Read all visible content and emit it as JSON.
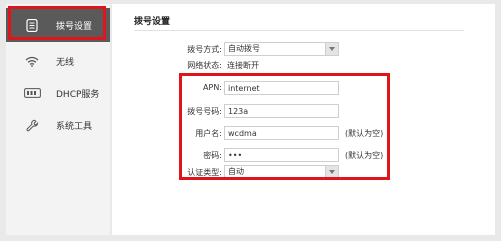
{
  "sidebar": {
    "items": [
      {
        "label": "拨号设置",
        "icon": "dialpad-icon",
        "active": true
      },
      {
        "label": "无线",
        "icon": "wifi-icon",
        "active": false
      },
      {
        "label": "DHCP服务",
        "icon": "dhcp-icon",
        "active": false
      },
      {
        "label": "系统工具",
        "icon": "wrench-icon",
        "active": false
      }
    ]
  },
  "main": {
    "title": "拨号设置",
    "dial_mode": {
      "label": "拨号方式:",
      "value": "自动拨号"
    },
    "network_status": {
      "label": "网络状态:",
      "value": "连接断开"
    },
    "apn": {
      "label": "APN:",
      "value": "internet"
    },
    "dial_number": {
      "label": "拨号号码:",
      "value": "123a"
    },
    "username": {
      "label": "用户名:",
      "value": "wcdma",
      "note": "(默认为空)"
    },
    "password": {
      "label": "密码:",
      "value": "•••",
      "note": "(默认为空)"
    },
    "auth_type": {
      "label": "认证类型:",
      "value": "自动"
    }
  },
  "colors": {
    "highlight": "#e0151b",
    "active_nav": "#5a5a5a"
  }
}
